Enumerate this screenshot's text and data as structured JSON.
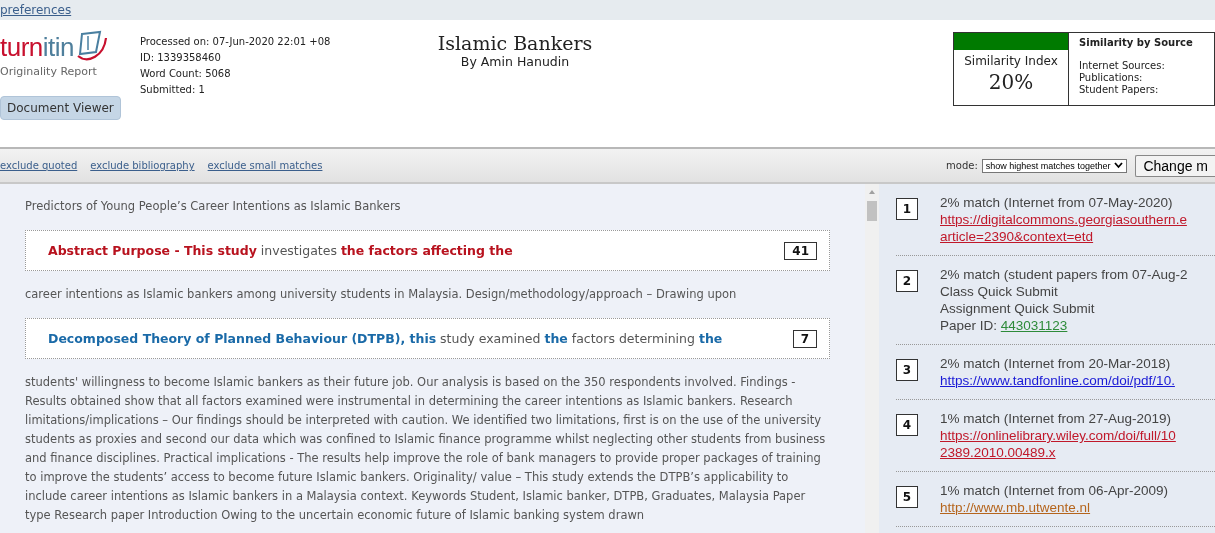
{
  "top_link": "preferences",
  "logo": {
    "parts": [
      "turn",
      "itin"
    ],
    "subtitle": "Originality Report"
  },
  "meta": [
    "Processed on: 07-Jun-2020 22:01 +08",
    "ID: 1339358460",
    "Word Count: 5068",
    "Submitted: 1"
  ],
  "document_viewer_button": "Document Viewer",
  "paper": {
    "title": "Islamic Bankers",
    "author": "By Amin Hanudin"
  },
  "similarity": {
    "label": "Similarity Index",
    "value": "20%",
    "color": "#007a00",
    "by_source_title": "Similarity by Source",
    "sources": [
      "Internet Sources:",
      "Publications:",
      "Student Papers:"
    ]
  },
  "filters": [
    "exclude quoted",
    "exclude bibliography",
    "exclude small matches"
  ],
  "mode": {
    "label": "mode:",
    "value": "show highest matches together",
    "button": "Change m"
  },
  "document": [
    {
      "kind": "text",
      "text": "Predictors of Young People’s Career Intentions as Islamic Bankers"
    },
    {
      "kind": "match",
      "text": "**Abstract Purpose - This study** investigates **the factors affecting the**",
      "number": "41",
      "color": "#b8121e"
    },
    {
      "kind": "text",
      "text": "career intentions as Islamic bankers among university students in Malaysia. Design/methodology/approach – Drawing upon"
    },
    {
      "kind": "match",
      "text": "**Decomposed Theory of Planned Behaviour (DTPB), this** study examined **the** factors determining **the**",
      "number": "7",
      "color": "#1a6aa8"
    },
    {
      "kind": "text",
      "text": "students' willingness to become Islamic bankers as their future job. Our analysis is based on the 350 respondents involved. Findings - Results obtained show that all factors examined were instrumental in determining the career intentions as Islamic bankers. Research limitations/implications – Our findings should be interpreted with caution. We identified two limitations, first is on the use of the university students as proxies and second our data which was confined to Islamic finance programme whilst neglecting other students from business and finance disciplines. Practical implications - The results help improve the role of bank managers to provide proper packages of training to improve the students’ access to become future Islamic bankers. Originality/ value – This study extends the DTPB’s applicability to include career intentions as Islamic bankers in a Malaysia context. Keywords Student, Islamic banker, DTPB, Graduates, Malaysia Paper type Research paper Introduction Owing to the uncertain economic future of Islamic banking system drawn"
    }
  ],
  "sources": [
    {
      "number": "1",
      "match": "2% match (Internet from 07-May-2020)",
      "link_lines": [
        "https://digitalcommons.georgiasouthern.e",
        "article=2390&context=etd"
      ],
      "color": "#c0182a"
    },
    {
      "number": "2",
      "match": "2% match (student papers from 07-Aug-2",
      "details": [
        "Class Quick Submit",
        "Assignment Quick Submit"
      ],
      "link_prefix": "Paper ID: ",
      "link_lines": [
        "443031123"
      ],
      "color": "#2e8b3a"
    },
    {
      "number": "3",
      "match": "2% match (Internet from 20-Mar-2018)",
      "link_lines": [
        "https://www.tandfonline.com/doi/pdf/10."
      ],
      "color": "#1a1ad6"
    },
    {
      "number": "4",
      "match": "1% match (Internet from 27-Aug-2019)",
      "link_lines": [
        "https://onlinelibrary.wiley.com/doi/full/10",
        "2389.2010.00489.x"
      ],
      "color": "#c0182a"
    },
    {
      "number": "5",
      "match": "1% match (Internet from 06-Apr-2009)",
      "link_lines": [
        "http://www.mb.utwente.nl"
      ],
      "color": "#b5651d"
    }
  ]
}
